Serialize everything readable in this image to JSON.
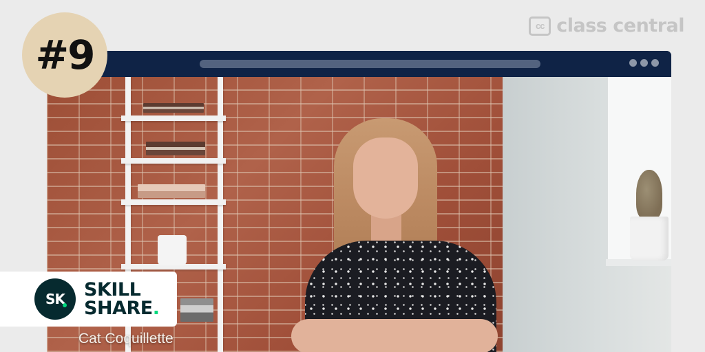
{
  "rank_badge": {
    "text": "#9"
  },
  "watermark": {
    "icon_text": "cc",
    "name": "class central"
  },
  "course_card": {
    "brand_monogram": "SK",
    "brand_line1": "SKILL",
    "brand_line2": "SHARE",
    "instructor": "Cat Coquillette"
  },
  "colors": {
    "badge": "#e5d3b3",
    "browser_frame": "#0f2346",
    "skillshare_dark": "#062a2f",
    "skillshare_green": "#00d97e"
  },
  "icons": [
    "class-central-logo-icon",
    "window-control-dots-icon",
    "skillshare-logo-icon"
  ]
}
